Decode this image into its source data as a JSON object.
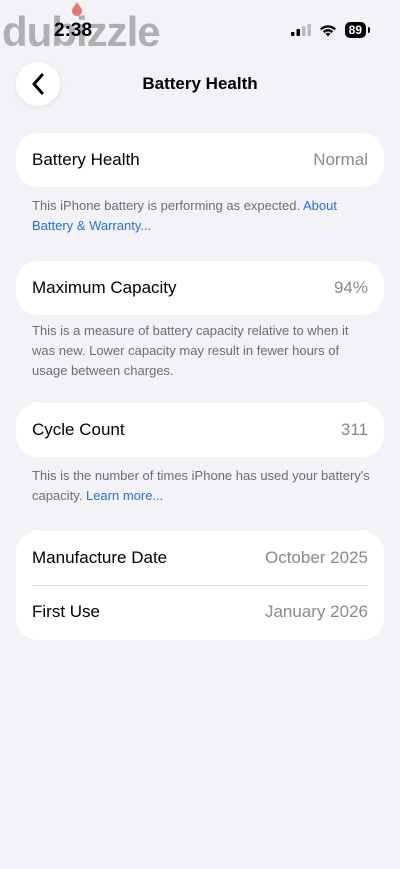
{
  "status_bar": {
    "time": "2:38",
    "battery_level": "89",
    "watermark": "dubizzle"
  },
  "nav": {
    "title": "Battery Health"
  },
  "sections": {
    "battery_health": {
      "label": "Battery Health",
      "value": "Normal",
      "footnote": "This iPhone battery is performing as expected.",
      "footnote_link": "About Battery & Warranty..."
    },
    "maximum_capacity": {
      "label": "Maximum Capacity",
      "value": "94%",
      "footnote": "This is a measure of battery capacity relative to when it was new. Lower capacity may result in fewer hours of usage between charges."
    },
    "cycle_count": {
      "label": "Cycle Count",
      "value": "311",
      "footnote": "This is the number of times iPhone has used your battery's capacity.",
      "footnote_link": "Learn more..."
    },
    "dates": {
      "manufacture_label": "Manufacture Date",
      "manufacture_value": "October 2025",
      "first_use_label": "First Use",
      "first_use_value": "January 2026"
    }
  },
  "colors": {
    "background": "#f2f2f7",
    "link": "#2a6fd6",
    "secondary_text": "#8a8a8e"
  }
}
